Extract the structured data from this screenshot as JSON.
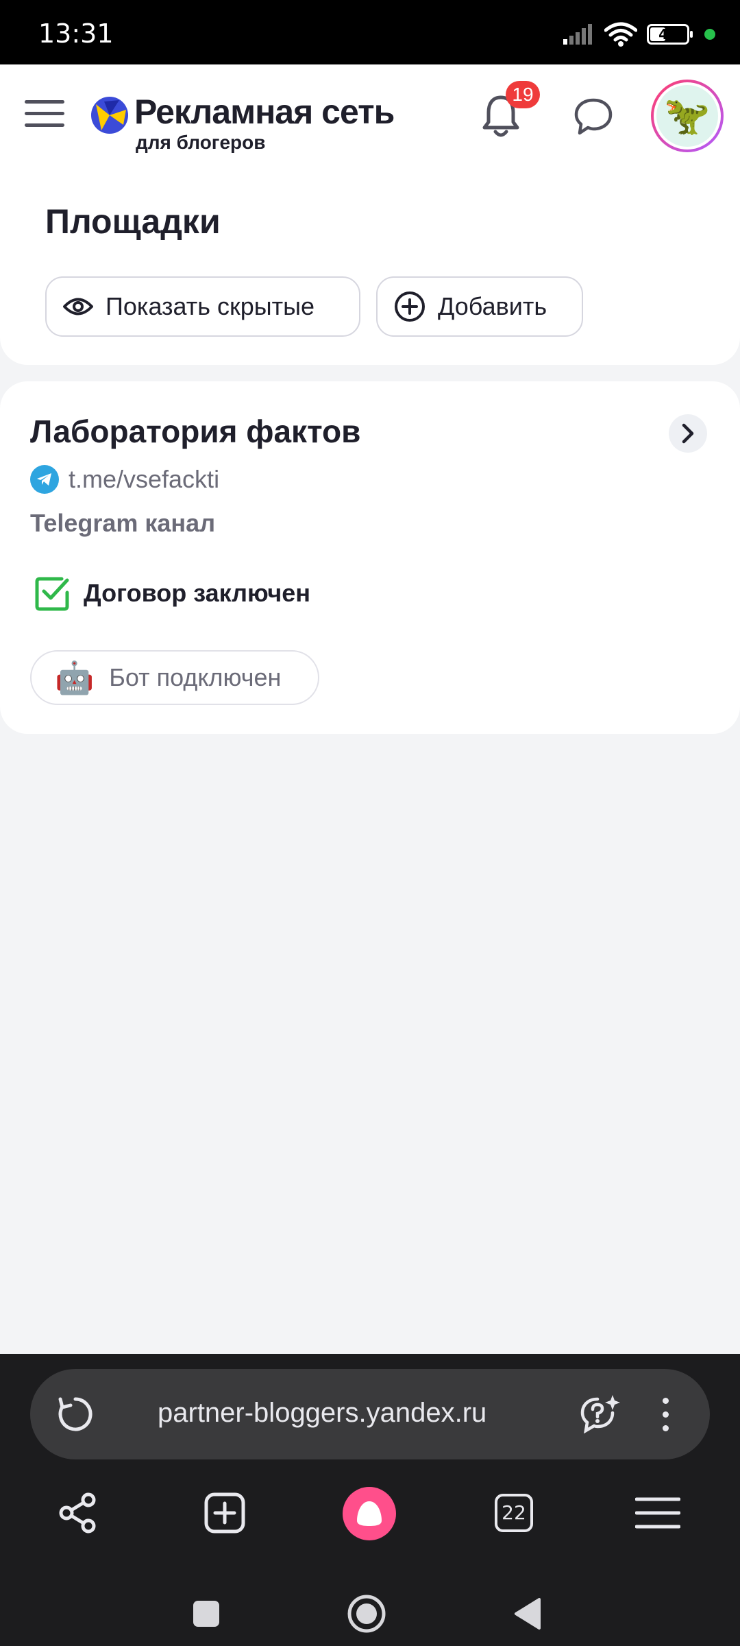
{
  "status_bar": {
    "time": "13:31",
    "battery_level": "41",
    "battery_fraction": 0.41,
    "icons": [
      "signal-icon",
      "wifi-icon",
      "battery-icon",
      "privacy-dot-icon"
    ]
  },
  "header": {
    "brand_title": "Рекламная сеть",
    "brand_subtitle": "для блогеров",
    "notifications_count": "19",
    "colors": {
      "accent": "#ef3b3b",
      "logo_blue": "#3b4bd8",
      "logo_yellow": "#ffcc00"
    }
  },
  "page": {
    "title": "Площадки",
    "show_hidden_label": "Показать скрытые",
    "add_label": "Добавить"
  },
  "site": {
    "name": "Лаборатория фактов",
    "link": "t.me/vsefackti",
    "type": "Telegram канал",
    "contract_status": "Договор заключен",
    "bot_status": "Бот подключен",
    "bot_emoji": "🤖",
    "status_color": "#2fb84a"
  },
  "browser": {
    "url": "partner-bloggers.yandex.ru",
    "tabs_count": "22",
    "alice_color": "#ff4f8b"
  },
  "avatar": {
    "emoji": "🦖"
  }
}
